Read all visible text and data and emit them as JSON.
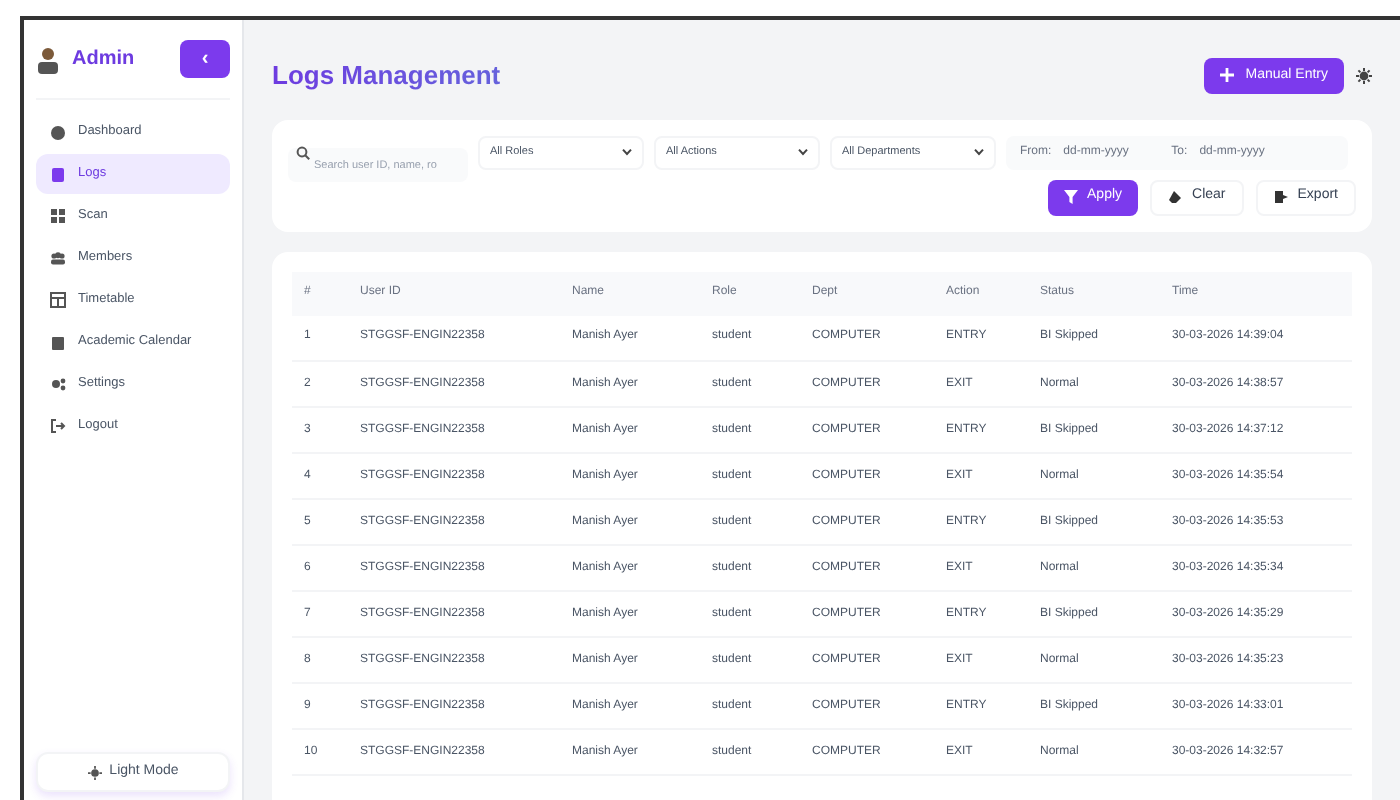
{
  "sidebar": {
    "brand": "Admin",
    "collapse_button": "‹",
    "items": [
      {
        "label": "Dashboard",
        "selected": false
      },
      {
        "label": "Logs",
        "selected": true
      },
      {
        "label": "Scan",
        "selected": false
      },
      {
        "label": "Members",
        "selected": false
      },
      {
        "label": "Timetable",
        "selected": false
      },
      {
        "label": "Academic Calendar",
        "selected": false
      },
      {
        "label": "Settings",
        "selected": false
      },
      {
        "label": "Logout",
        "selected": false
      }
    ],
    "theme_button": "Light Mode"
  },
  "header": {
    "title": "Logs Management",
    "manual_entry_button": "Manual Entry"
  },
  "filters": {
    "search": {
      "placeholder": "Search user ID, name, ro"
    },
    "selects": [
      "All Roles",
      "All Actions",
      "All Departments"
    ],
    "from_label": "From:",
    "from_placeholder": "dd-mm-yyyy",
    "to_label": "To:",
    "to_placeholder": "dd-mm-yyyy",
    "buttons": [
      {
        "label": "Apply",
        "kind": "primary"
      },
      {
        "label": "Clear",
        "kind": "eraser"
      },
      {
        "label": "Export",
        "kind": "export"
      }
    ]
  },
  "table": {
    "columns": [
      "#",
      "User ID",
      "Name",
      "Role",
      "Dept",
      "Action",
      "Status",
      "Time"
    ],
    "rows": [
      [
        "1",
        "STGGSF-ENGIN22358",
        "Manish Ayer",
        "student",
        "COMPUTER",
        "ENTRY",
        "BI Skipped",
        "30-03-2026 14:39:04"
      ],
      [
        "2",
        "STGGSF-ENGIN22358",
        "Manish Ayer",
        "student",
        "COMPUTER",
        "EXIT",
        "Normal",
        "30-03-2026 14:38:57"
      ],
      [
        "3",
        "STGGSF-ENGIN22358",
        "Manish Ayer",
        "student",
        "COMPUTER",
        "ENTRY",
        "BI Skipped",
        "30-03-2026 14:37:12"
      ],
      [
        "4",
        "STGGSF-ENGIN22358",
        "Manish Ayer",
        "student",
        "COMPUTER",
        "EXIT",
        "Normal",
        "30-03-2026 14:35:54"
      ],
      [
        "5",
        "STGGSF-ENGIN22358",
        "Manish Ayer",
        "student",
        "COMPUTER",
        "ENTRY",
        "BI Skipped",
        "30-03-2026 14:35:53"
      ],
      [
        "6",
        "STGGSF-ENGIN22358",
        "Manish Ayer",
        "student",
        "COMPUTER",
        "EXIT",
        "Normal",
        "30-03-2026 14:35:34"
      ],
      [
        "7",
        "STGGSF-ENGIN22358",
        "Manish Ayer",
        "student",
        "COMPUTER",
        "ENTRY",
        "BI Skipped",
        "30-03-2026 14:35:29"
      ],
      [
        "8",
        "STGGSF-ENGIN22358",
        "Manish Ayer",
        "student",
        "COMPUTER",
        "EXIT",
        "Normal",
        "30-03-2026 14:35:23"
      ],
      [
        "9",
        "STGGSF-ENGIN22358",
        "Manish Ayer",
        "student",
        "COMPUTER",
        "ENTRY",
        "BI Skipped",
        "30-03-2026 14:33:01"
      ],
      [
        "10",
        "STGGSF-ENGIN22358",
        "Manish Ayer",
        "student",
        "COMPUTER",
        "EXIT",
        "Normal",
        "30-03-2026 14:32:57"
      ]
    ]
  }
}
